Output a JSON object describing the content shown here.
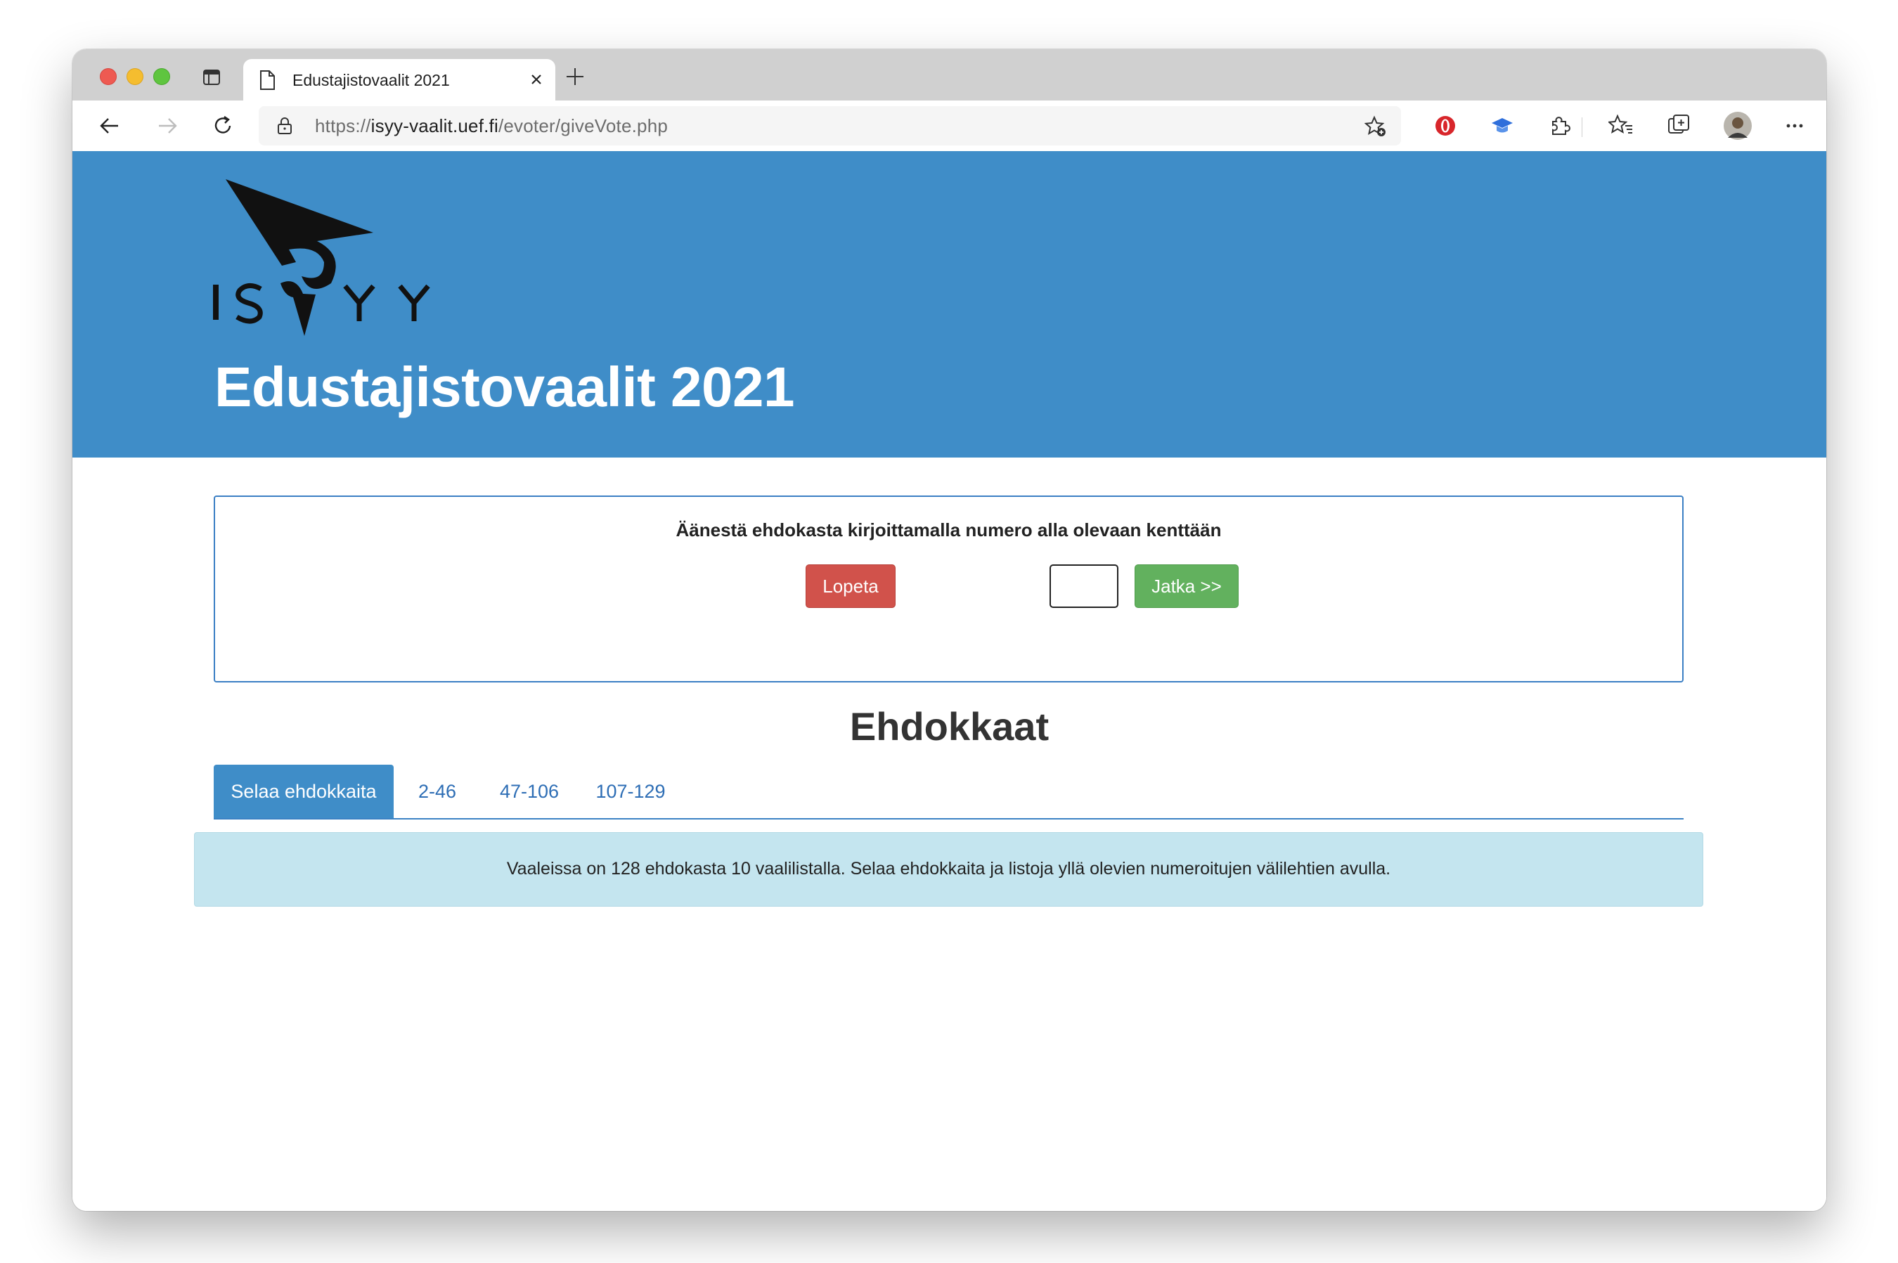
{
  "browser": {
    "tab_title": "Edustajistovaalit 2021",
    "url_scheme": "https://",
    "url_host": "isyy-vaalit.uef.fi",
    "url_path": "/evoter/giveVote.php"
  },
  "header": {
    "logo_text": "ISYY",
    "title": "Edustajistovaalit 2021"
  },
  "vote_panel": {
    "instruction": "Äänestä ehdokasta kirjoittamalla numero alla olevaan kenttään",
    "stop_label": "Lopeta",
    "input_value": "",
    "next_label": "Jatka >>"
  },
  "candidates": {
    "heading": "Ehdokkaat",
    "tabs": [
      {
        "label": "Selaa ehdokkaita",
        "active": true
      },
      {
        "label": "2-46",
        "active": false
      },
      {
        "label": "47-106",
        "active": false
      },
      {
        "label": "107-129",
        "active": false
      }
    ],
    "info": "Vaaleissa on 128 ehdokasta 10 vaalilistalla. Selaa ehdokkaita ja listoja yllä olevien numeroitujen välilehtien avulla."
  },
  "colors": {
    "banner": "#3f8dc8",
    "stop_button": "#d1524b",
    "next_button": "#62b15e",
    "info_box": "#c4e5ef",
    "tab_link": "#2e6eb5"
  }
}
